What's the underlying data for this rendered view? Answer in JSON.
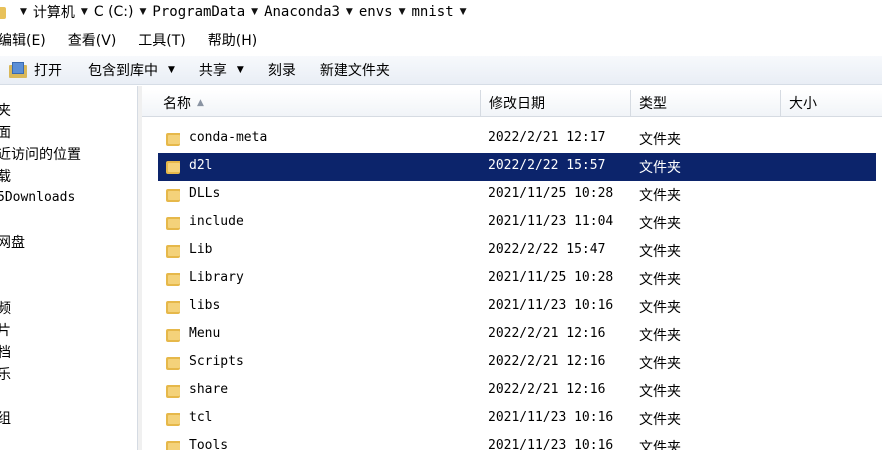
{
  "address_bar": {
    "crumbs": [
      "计算机",
      "C (C:)",
      "ProgramData",
      "Anaconda3",
      "envs",
      "mnist"
    ]
  },
  "menu": {
    "items": [
      "编辑(E)",
      "查看(V)",
      "工具(T)",
      "帮助(H)"
    ]
  },
  "toolbar": {
    "open": "打开",
    "include_in_library": "包含到库中",
    "share": "共享",
    "burn": "刻录",
    "new_folder": "新建文件夹"
  },
  "nav_pane": {
    "items": [
      "夹",
      "面",
      "近访问的位置",
      "载",
      "5Downloads",
      "网盘",
      "频",
      "片",
      "档",
      "乐",
      "组"
    ]
  },
  "columns": {
    "name": "名称",
    "modified": "修改日期",
    "type": "类型",
    "size": "大小"
  },
  "files": [
    {
      "name": "conda-meta",
      "modified": "2022/2/21 12:17",
      "type": "文件夹"
    },
    {
      "name": "d2l",
      "modified": "2022/2/22 15:57",
      "type": "文件夹",
      "selected": true
    },
    {
      "name": "DLLs",
      "modified": "2021/11/25 10:28",
      "type": "文件夹"
    },
    {
      "name": "include",
      "modified": "2021/11/23 11:04",
      "type": "文件夹"
    },
    {
      "name": "Lib",
      "modified": "2022/2/22 15:47",
      "type": "文件夹"
    },
    {
      "name": "Library",
      "modified": "2021/11/25 10:28",
      "type": "文件夹"
    },
    {
      "name": "libs",
      "modified": "2021/11/23 10:16",
      "type": "文件夹"
    },
    {
      "name": "Menu",
      "modified": "2022/2/21 12:16",
      "type": "文件夹"
    },
    {
      "name": "Scripts",
      "modified": "2022/2/21 12:16",
      "type": "文件夹"
    },
    {
      "name": "share",
      "modified": "2022/2/21 12:16",
      "type": "文件夹"
    },
    {
      "name": "tcl",
      "modified": "2021/11/23 10:16",
      "type": "文件夹"
    },
    {
      "name": "Tools",
      "modified": "2021/11/23 10:16",
      "type": "文件夹"
    }
  ],
  "icons": {
    "folder": "folder-icon",
    "dropdown": "chevron-down-icon",
    "sort": "sort-ascending-icon",
    "open": "open-icon"
  },
  "colors": {
    "selection": "#0c246b",
    "folder": "#e6b84a",
    "toolbar": "#e9eef5"
  }
}
